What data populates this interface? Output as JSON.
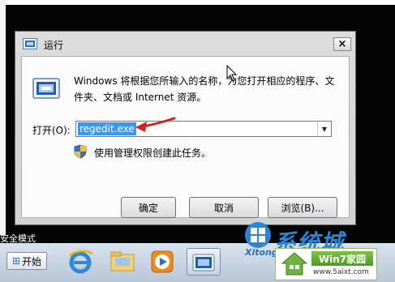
{
  "dialog": {
    "title": "运行",
    "close_label": "×",
    "description": "Windows 将根据您所输入的名称，为您打开相应的程序、文件夹、文档或 Internet 资源。",
    "open_label": "打开(O):",
    "input_value": "regedit.exe",
    "admin_note": "使用管理权限创建此任务。",
    "ok_label": "确定",
    "cancel_label": "取消",
    "browse_label": "浏览(B)..."
  },
  "desktop": {
    "partial_text": "安全模式"
  },
  "taskbar": {
    "start_label": "开始",
    "start_flag_glyph": "⊞",
    "items": [
      "internet-explorer-icon",
      "folder-icon",
      "media-player-icon",
      "run-icon"
    ]
  },
  "watermark": {
    "logo_text": "系统城",
    "sub_text": "Xitong",
    "badge_title": "Win7家园",
    "badge_url": "www.5aixt.com"
  },
  "colors": {
    "selection": "#3399ff",
    "arrow": "#d42020",
    "taskbar": "#c9d5e4",
    "badge_green": "#5aa52f"
  }
}
